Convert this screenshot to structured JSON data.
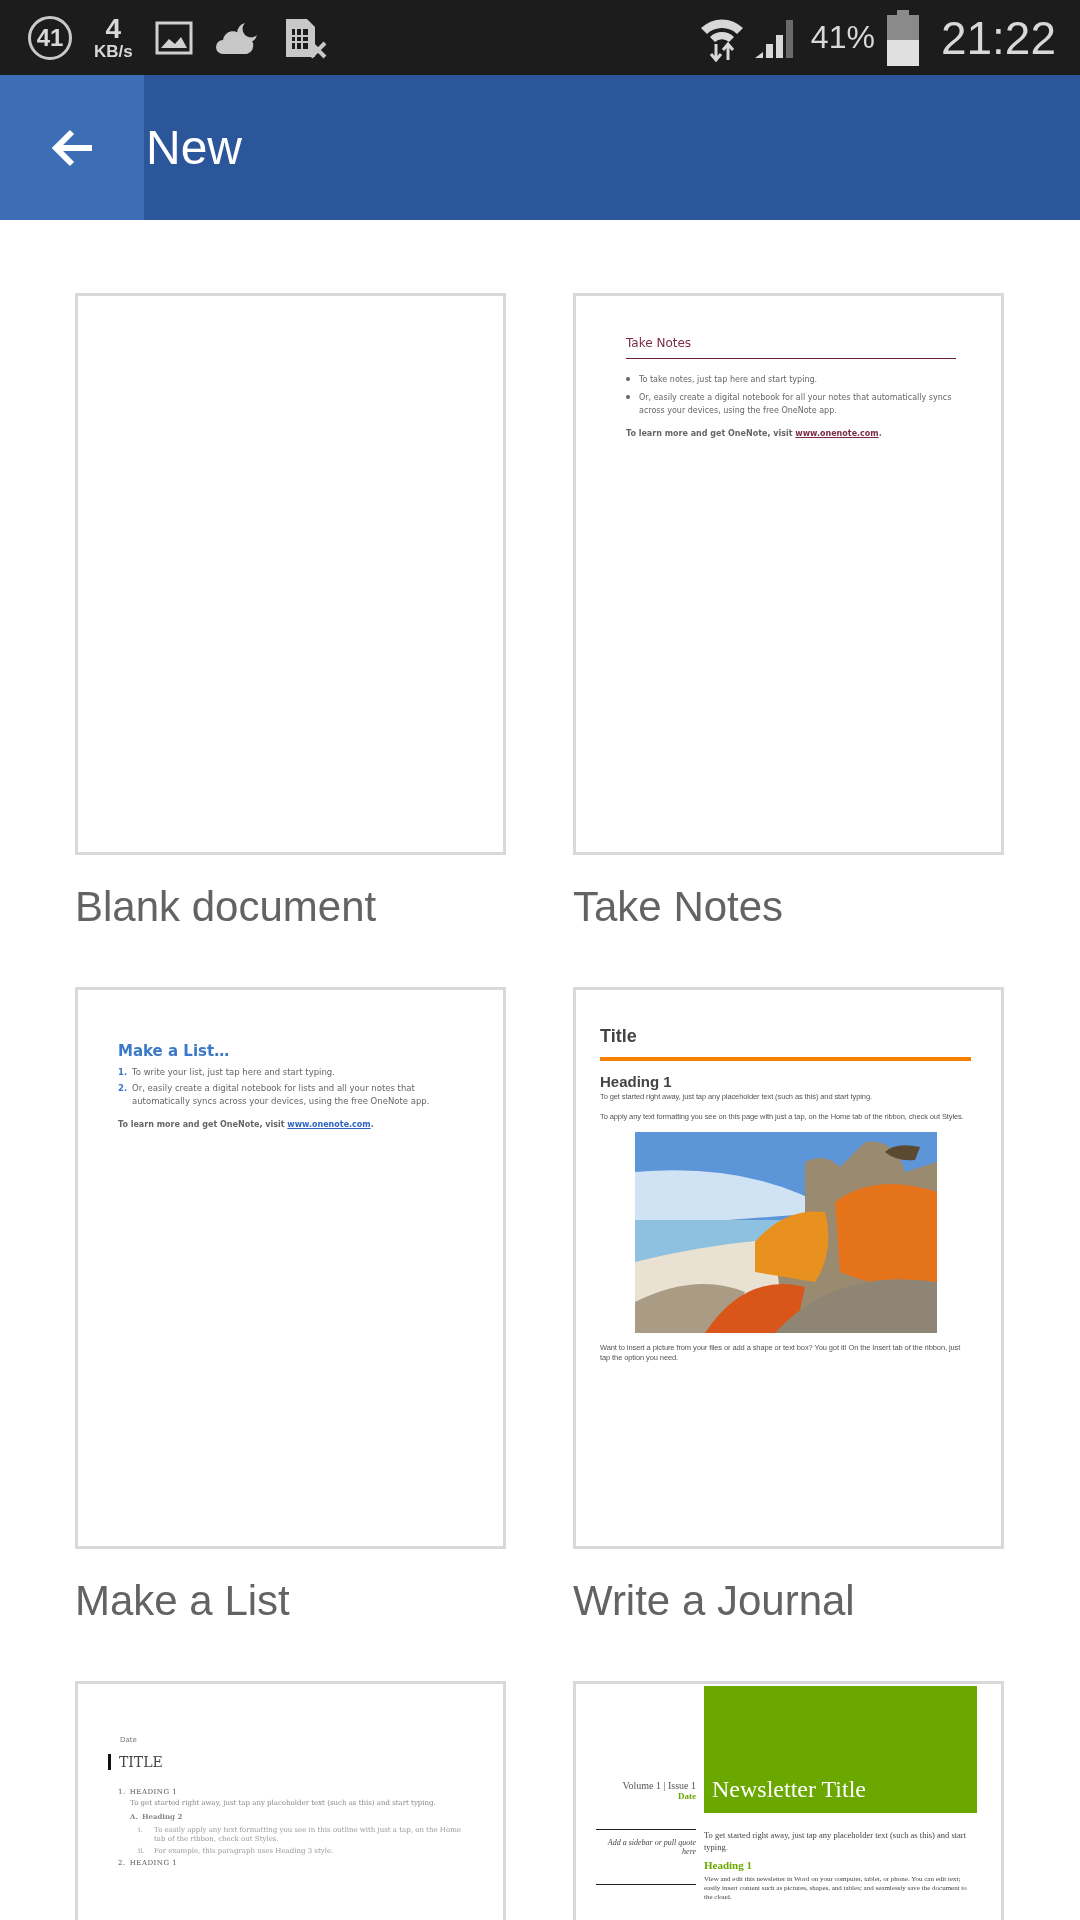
{
  "status_bar": {
    "notification_count": "41",
    "speed_value": "4",
    "speed_unit": "KB/s",
    "battery": "41%",
    "time": "21:22"
  },
  "app_bar": {
    "title": "New"
  },
  "templates": [
    {
      "kind": "blank",
      "name": "Blank document"
    },
    {
      "kind": "notes",
      "name": "Take Notes",
      "title": "Take Notes",
      "bullets": [
        "To take notes, just tap here and start typing.",
        "Or, easily create a digital notebook for all your notes that automatically syncs across your devices, using the free OneNote app."
      ],
      "footer_text": "To learn more and get OneNote, visit",
      "footer_link": "www.onenote.com",
      "footer_end": "."
    },
    {
      "kind": "list",
      "name": "Make a List",
      "title": "Make a List…",
      "items": [
        {
          "number": "1.",
          "text": "To write your list, just tap here and start typing."
        },
        {
          "number": "2.",
          "text": "Or, easily create a digital notebook for lists and all your notes that automatically syncs across your devices, using the free OneNote app."
        }
      ],
      "footer_text": "To learn more and get OneNote, visit",
      "footer_link": "www.onenote.com",
      "footer_end": "."
    },
    {
      "kind": "journal",
      "name": "Write a Journal",
      "title": "Title",
      "heading": "Heading 1",
      "paragraphs": [
        "To get started right away, just tap any placeholder text (such as this) and start typing.",
        "To apply any text formatting you see on this page with just a tap, on the Home tab of the ribbon, check out Styles."
      ],
      "closing": "Want to insert a picture from your files or add a shape or text box? You got it! On the Insert tab of the ribbon, just tap the option you need."
    },
    {
      "kind": "outline",
      "date": "Date",
      "title": "TITLE",
      "sections": [
        {
          "number": "1.",
          "heading": "HEADING 1",
          "text": "To get started right away, just tap any placeholder text (such as this) and start typing.",
          "subsections": [
            {
              "letter": "A.",
              "heading": "Heading 2",
              "items": [
                {
                  "marker": "i.",
                  "text": "To easily apply any text formatting you see in this outline with just a tap, on the Home tab of the ribbon, check out Styles."
                },
                {
                  "marker": "ii.",
                  "text": "For example, this paragraph uses Heading 3 style."
                }
              ]
            }
          ]
        },
        {
          "number": "2.",
          "heading": "HEADING 1"
        }
      ]
    },
    {
      "kind": "newsletter",
      "volume": "Volume 1 | Issue 1",
      "date": "Date",
      "title": "Newsletter Title",
      "sidebar": "Add a sidebar or pull quote here",
      "intro": "To get started right away, just tap any placeholder text (such as this) and start typing.",
      "heading": "Heading 1",
      "body": "View and edit this newsletter in Word on your computer, tablet, or phone. You can edit text; easily insert content such as pictures, shapes, and tables; and seamlessly save the document to the cloud."
    }
  ]
}
